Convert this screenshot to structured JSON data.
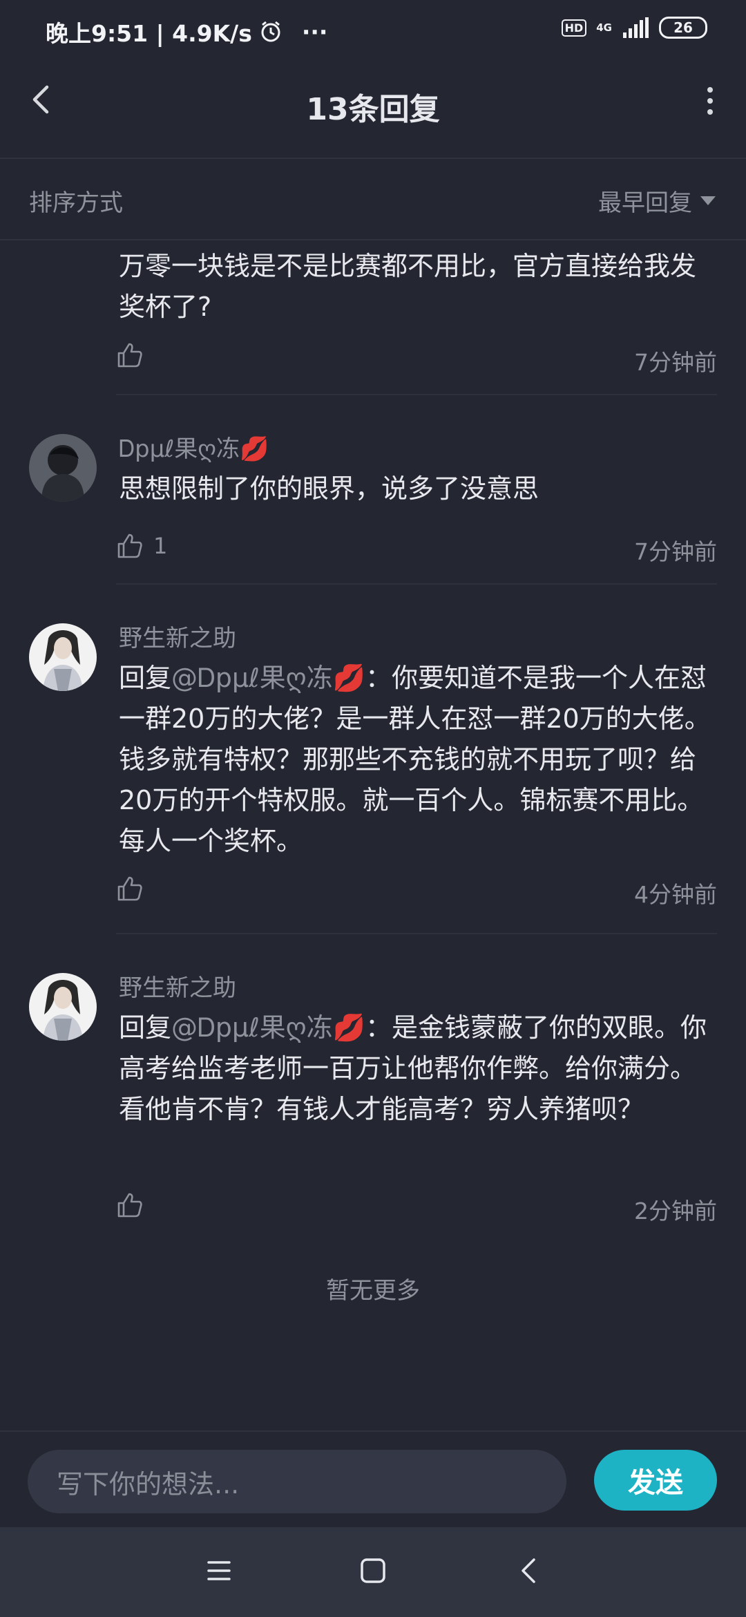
{
  "status_bar": {
    "time_speed": "晚上9:51 | 4.9K/s",
    "more": "···",
    "hd": "HD",
    "network": "4G",
    "battery": "26"
  },
  "header": {
    "title": "13条回复"
  },
  "sort": {
    "label": "排序方式",
    "value": "最早回复"
  },
  "comments": [
    {
      "text": "万零一块钱是不是比赛都不用比，官方直接给我发奖杯了?",
      "likes": "",
      "time": "7分钟前"
    },
    {
      "username": "Ꭰpμℓ果ღ冻💋",
      "text": "思想限制了你的眼界，说多了没意思",
      "likes": "1",
      "time": "7分钟前"
    },
    {
      "username": "野生新之助",
      "reply_prefix": "回复",
      "mention": "@Ꭰpμℓ果ღ冻💋",
      "text": "：你要知道不是我一个人在怼一群20万的大佬？是一群人在怼一群20万的大佬。钱多就有特权？那那些不充钱的就不用玩了呗？给20万的开个特权服。就一百个人。锦标赛不用比。每人一个奖杯。",
      "likes": "",
      "time": "4分钟前"
    },
    {
      "username": "野生新之助",
      "reply_prefix": "回复",
      "mention": "@Ꭰpμℓ果ღ冻💋",
      "text": "：是金钱蒙蔽了你的双眼。你高考给监考老师一百万让他帮你作弊。给你满分。看他肯不肯？有钱人才能高考？穷人养猪呗？",
      "likes": "",
      "time": "2分钟前"
    }
  ],
  "footer_note": "暂无更多",
  "composer": {
    "placeholder": "写下你的想法...",
    "send_label": "发送"
  },
  "colors": {
    "background": "#242631",
    "accent": "#1db2c4",
    "secondary_text": "#8e929a"
  }
}
